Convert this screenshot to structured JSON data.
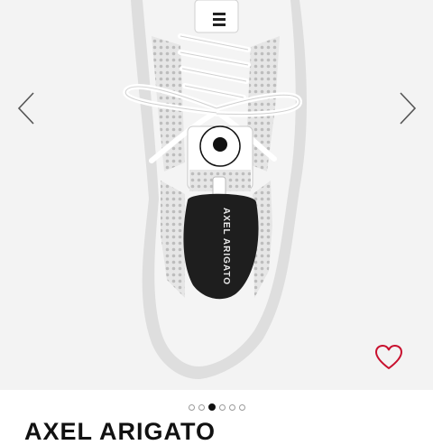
{
  "product": {
    "brand": "AXEL ARIGATO",
    "tongue_label": "AXEL ARIGATO",
    "images": [
      {
        "active": false
      },
      {
        "active": false
      },
      {
        "active": true
      },
      {
        "active": false
      },
      {
        "active": false
      },
      {
        "active": false
      }
    ]
  },
  "icons": {
    "prev": "chevron-left-icon",
    "next": "chevron-right-icon",
    "wishlist": "heart-outline-icon"
  },
  "colors": {
    "accent": "#c8102e",
    "text": "#111111",
    "arrow": "#555555"
  }
}
